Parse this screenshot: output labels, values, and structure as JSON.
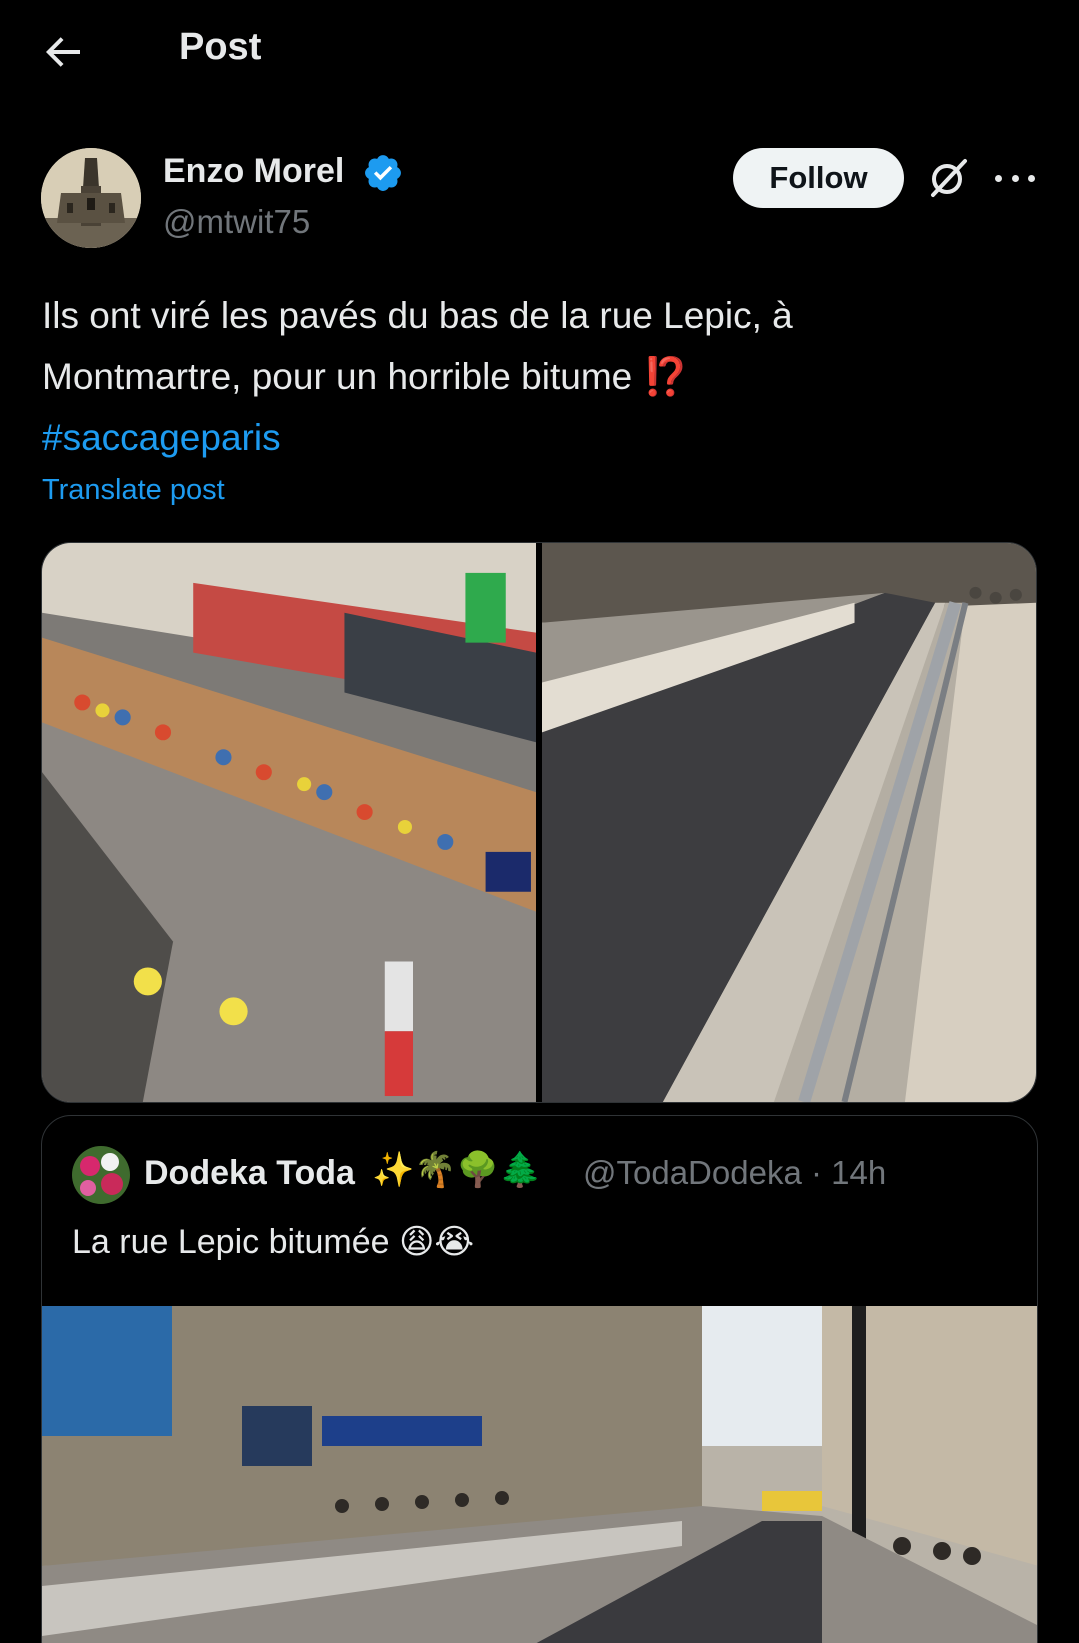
{
  "header": {
    "title": "Post",
    "back_icon": "arrow-left-icon"
  },
  "author": {
    "name": "Enzo Morel",
    "handle": "@mtwit75",
    "verified": true,
    "verified_color": "#1d9bf0",
    "avatar_icon": "church-photo-avatar"
  },
  "actions": {
    "follow_label": "Follow",
    "grok_icon": "grok-icon",
    "more_icon": "more-icon"
  },
  "post": {
    "line1": "Ils ont viré les pavés du bas de la rue Lepic, à",
    "line2": "Montmartre, pour un horrible bitume ",
    "emoji": "⁉️",
    "hashtag": "#saccageparis",
    "translate_label": "Translate post"
  },
  "media": [
    {
      "icon": "photo-crowd-cobblestone-street"
    },
    {
      "icon": "photo-asphalt-street"
    }
  ],
  "quote": {
    "name": "Dodeka Toda",
    "name_emojis": "✨🌴🌳🌲",
    "handle_time": "@TodaDodeka · 14h",
    "text": "La rue Lepic bitumée 😩😭",
    "image_icon": "photo-asphalt-street-wide"
  },
  "colors": {
    "background": "#000000",
    "text": "#e7e9ea",
    "muted": "#71767b",
    "accent": "#1d9bf0",
    "border": "#2f3336"
  }
}
